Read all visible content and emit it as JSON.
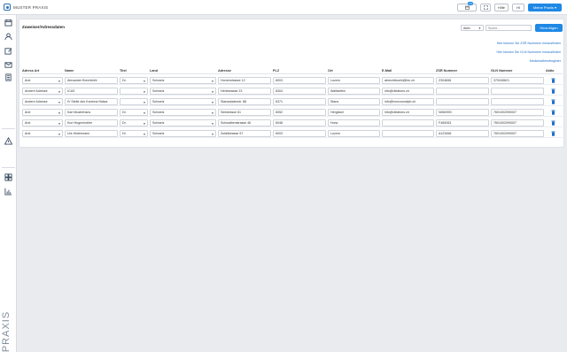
{
  "app": {
    "title": "MUSTER PRAXIS"
  },
  "topbar": {
    "calendar_badge": "14",
    "help_label": "Hilfe",
    "user_initials": "HI",
    "practice_button": "Meine Praxis ▾"
  },
  "panel": {
    "title": "Zuweiser/Adressdaten",
    "status_value": "Aktiv",
    "search_placeholder": "Suche...",
    "add_button": "Hinzufügen",
    "links": [
      "Hier können Sie ZSR Nummern herausfinden",
      "Hier können Sie GLN Nummern herausfinden",
      "Medizinalberufregister"
    ]
  },
  "table": {
    "headers": [
      "Adress Art",
      "Name",
      "Titel",
      "Land",
      "Adresse",
      "PLZ",
      "Ort",
      "E-Mail",
      "ZSR Nummer",
      "GLN Nummer",
      "Aktio"
    ],
    "rows": [
      {
        "art": "Arzt",
        "name": "Alexander Brechbühl",
        "titel": "Dr.",
        "land": "Schweiz",
        "adresse": "Hornerstrasse 12",
        "plz": "6003",
        "ort": "Luzern",
        "email": "abrechtbuehl@hin.ch",
        "zsr": "Z304656",
        "gln": "370045621"
      },
      {
        "art": "Andere Adresse",
        "name": "ICAS",
        "titel": "",
        "land": "Schweiz",
        "adresse": "Herbstrasse 23",
        "plz": "8304",
        "ort": "Wallisellen",
        "email": "info@delafons.ch",
        "zsr": "",
        "gln": ""
      },
      {
        "art": "Andere Adresse",
        "name": "IV Stelle des Kantons Nidwa",
        "titel": "",
        "land": "Schweiz",
        "adresse": "Stansstaderstr. 88",
        "plz": "6371",
        "ort": "Stans",
        "email": "info@ivnovovoelpb.ch",
        "zsr": "",
        "gln": ""
      },
      {
        "art": "Arzt",
        "name": "Karl Musterhans",
        "titel": "Dr.",
        "land": "Schweiz",
        "adresse": "Seestrasse 61",
        "plz": "6052",
        "ort": "Hergiswil",
        "email": "info@delafons.ch",
        "zsr": "N060993",
        "gln": "7601002090007"
      },
      {
        "art": "Arzt",
        "name": "Kurt Hugenhobler",
        "titel": "Dr.",
        "land": "Schweiz",
        "adresse": "Schwalbenstrasse 46",
        "plz": "6048",
        "ort": "Horw",
        "email": "",
        "zsr": "F465263",
        "gln": "7601002090007"
      },
      {
        "art": "Arzt",
        "name": "Urs Hintermann",
        "titel": "Dr.",
        "land": "Schweiz",
        "adresse": "Zufallstrasse 57",
        "plz": "6003",
        "ort": "Luzern",
        "email": "",
        "zsr": "A123456",
        "gln": "7601002090007"
      }
    ]
  },
  "sidebar": {
    "brand": "PRAXIS"
  }
}
